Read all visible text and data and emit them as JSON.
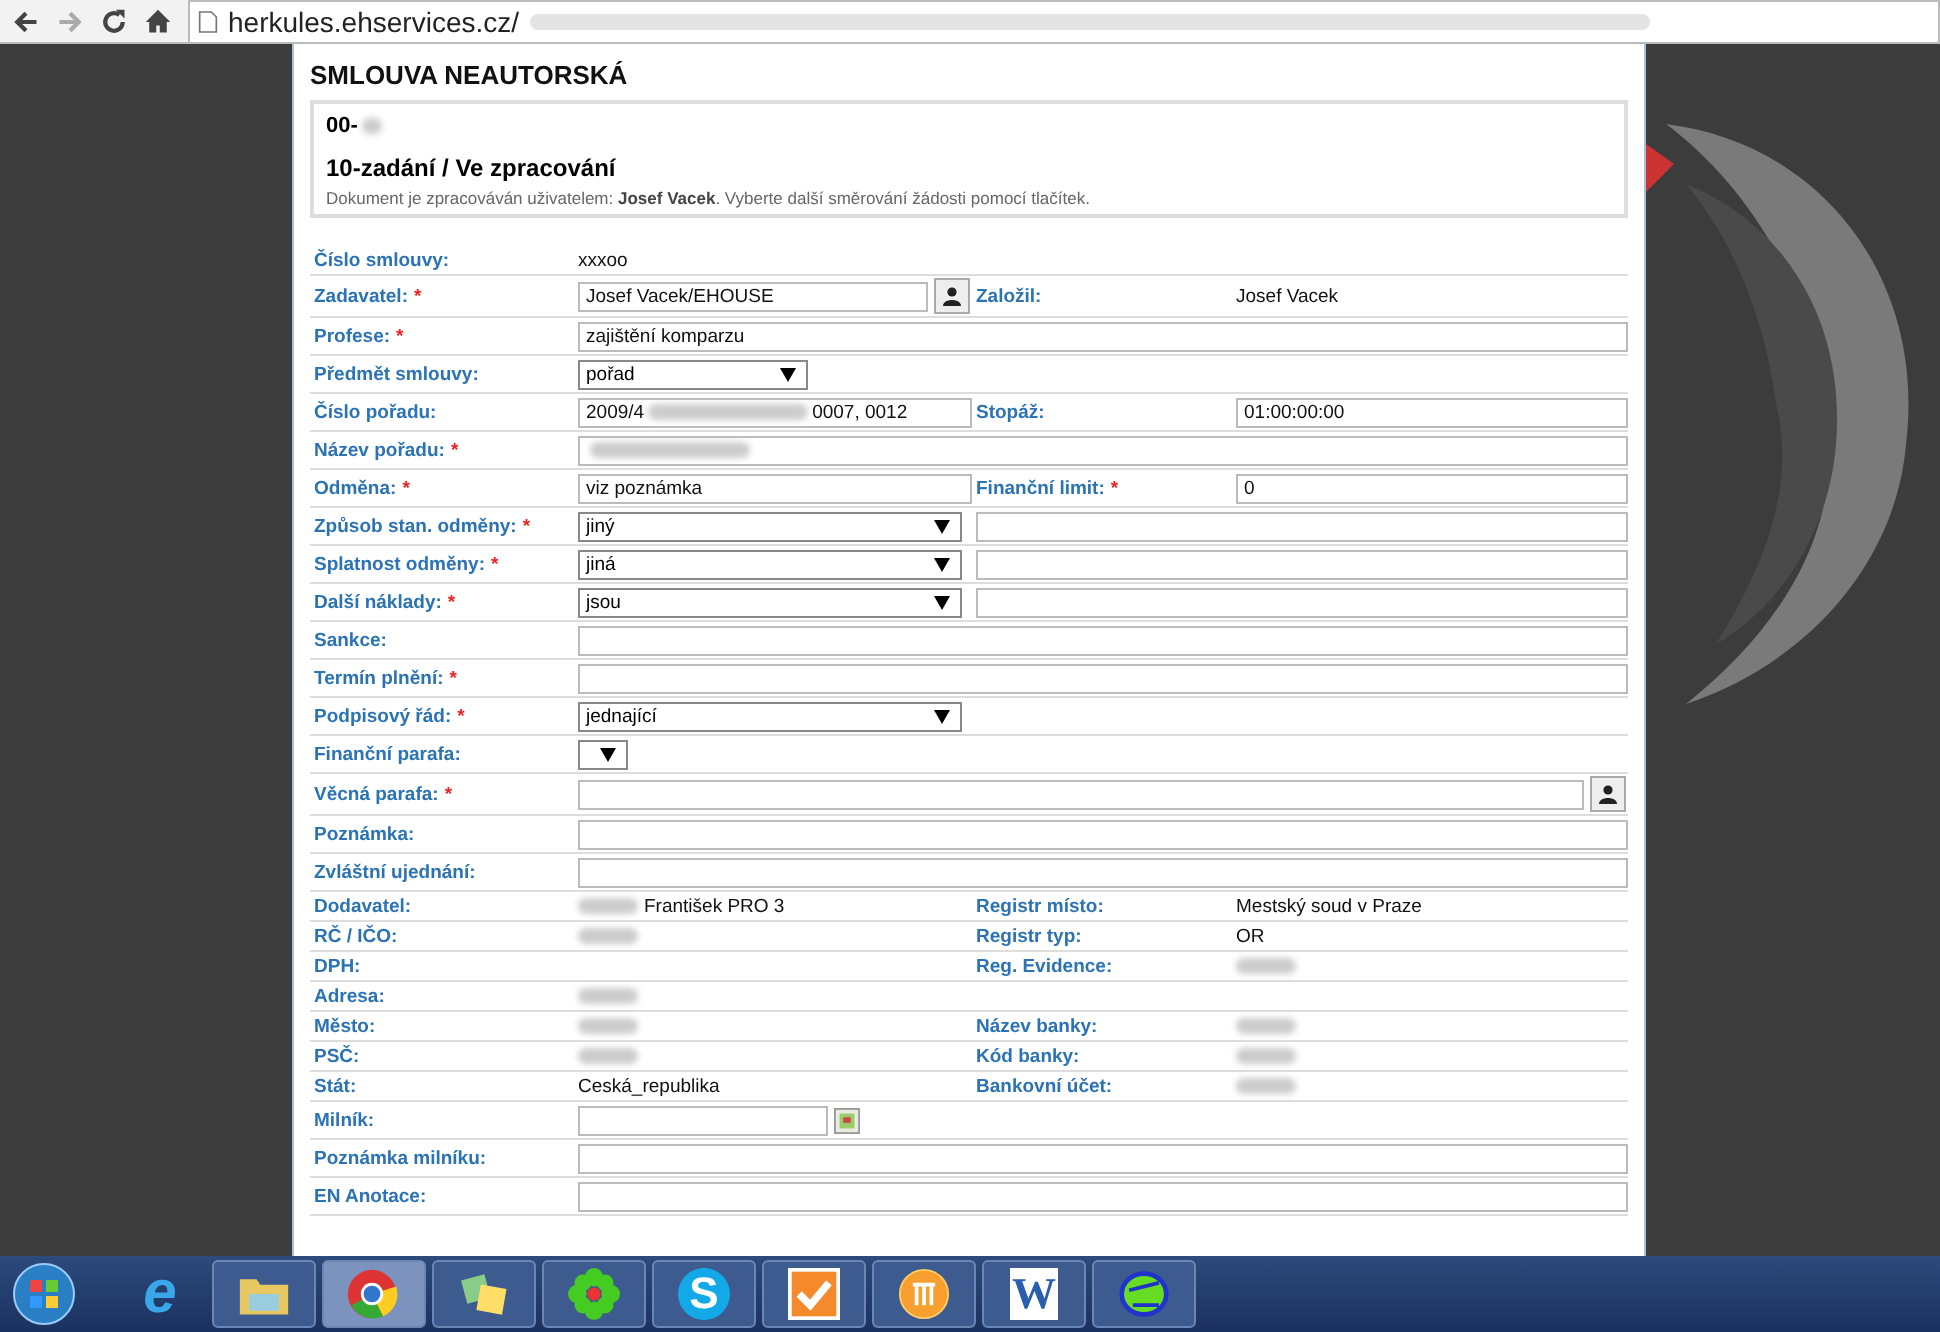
{
  "browser": {
    "url": "herkules.ehservices.cz/"
  },
  "form": {
    "title": "SMLOUVA NEAUTORSKÁ",
    "header": {
      "number": "00-",
      "status": "10-zadání / Ve zpracování",
      "note": "Dokument je zpracováván uživatelem: **Josef Vacek**. Vyberte další směrování žádosti pomocí tlačítek."
    },
    "rows": [
      {
        "label": "Číslo smlouvy:",
        "field": {
          "kind": "static",
          "value": "xxxoo"
        }
      },
      {
        "label": "Zadavatel:",
        "mark": "*",
        "field": {
          "kind": "input-person",
          "value": "Josef Vacek/EHOUSE"
        },
        "label2": "Založil:",
        "field2": {
          "kind": "static",
          "value": "Josef Vacek"
        }
      },
      {
        "label": "Profese:",
        "mark": "*",
        "field": {
          "kind": "input-full",
          "value": "zajištění komparzu"
        }
      },
      {
        "label": "Předmět smlouvy:",
        "field": {
          "kind": "select-short",
          "value": "pořad"
        }
      },
      {
        "label": "Číslo pořadu:",
        "field": {
          "kind": "input",
          "parts": [
            {
              "kind": "text",
              "text": "2009/4"
            },
            {
              "kind": "blur"
            },
            {
              "kind": "text",
              "text": "0007, 0012"
            }
          ]
        },
        "label2": "Stopáž:",
        "field2": {
          "kind": "input",
          "value": "01:00:00:00"
        }
      },
      {
        "label": "Název pořadu:",
        "mark": "*",
        "field": {
          "kind": "input-full",
          "parts": [
            {
              "kind": "blur"
            }
          ]
        }
      },
      {
        "label": "Odměna:",
        "mark": "*",
        "field": {
          "kind": "input",
          "value": "viz poznámka"
        },
        "label2": "Finanční limit:",
        "mark2": "*",
        "field2": {
          "kind": "input",
          "value": "0"
        }
      },
      {
        "label": "Způsob stan. odměny:",
        "mark": "*",
        "field": {
          "kind": "select",
          "value": "jiný"
        },
        "field2": {
          "kind": "input-wide"
        }
      },
      {
        "label": "Splatnost odměny:",
        "mark": "*",
        "field": {
          "kind": "select",
          "value": "jiná"
        },
        "field2": {
          "kind": "input-wide"
        }
      },
      {
        "label": "Další náklady:",
        "mark": "*",
        "field": {
          "kind": "select",
          "value": "jsou"
        },
        "field2": {
          "kind": "input-wide"
        }
      },
      {
        "label": "Sankce:",
        "field": {
          "kind": "input-full"
        }
      },
      {
        "label": "Termín plnění:",
        "mark": "*",
        "field": {
          "kind": "input-full"
        }
      },
      {
        "label": "Podpisový řád:",
        "mark": "*",
        "field": {
          "kind": "select",
          "value": "jednající"
        }
      },
      {
        "label": "Finanční parafa:",
        "field": {
          "kind": "select-tiny"
        }
      },
      {
        "label": "Věcná parafa:",
        "mark": "*",
        "field": {
          "kind": "input-full-person"
        }
      },
      {
        "label": "Poznámka:",
        "field": {
          "kind": "input-full"
        }
      },
      {
        "label": "Zvláštní ujednání:",
        "field": {
          "kind": "input-full"
        }
      },
      {
        "label": "Dodavatel:",
        "field": {
          "kind": "static",
          "parts": [
            {
              "kind": "blur"
            },
            {
              "kind": "text",
              "text": "František PRO 3"
            }
          ]
        },
        "label2": "Registr místo:",
        "field2": {
          "kind": "static",
          "value": "Mestský soud v Praze"
        }
      },
      {
        "label": "RČ / IČO:",
        "field": {
          "kind": "static",
          "parts": [
            {
              "kind": "blur"
            }
          ]
        },
        "label2": "Registr typ:",
        "field2": {
          "kind": "static",
          "value": "OR"
        }
      },
      {
        "label": "DPH:",
        "field": {
          "kind": "static"
        },
        "label2": "Reg. Evidence:",
        "field2": {
          "kind": "static",
          "parts": [
            {
              "kind": "blur"
            }
          ]
        }
      },
      {
        "label": "Adresa:",
        "field": {
          "kind": "static",
          "parts": [
            {
              "kind": "blur"
            }
          ]
        }
      },
      {
        "label": "Město:",
        "field": {
          "kind": "static",
          "parts": [
            {
              "kind": "blur"
            }
          ]
        },
        "label2": "Název banky:",
        "field2": {
          "kind": "static",
          "parts": [
            {
              "kind": "blur"
            }
          ]
        }
      },
      {
        "label": "PSČ:",
        "field": {
          "kind": "static",
          "parts": [
            {
              "kind": "blur"
            }
          ]
        },
        "label2": "Kód banky:",
        "field2": {
          "kind": "static",
          "parts": [
            {
              "kind": "blur"
            }
          ]
        }
      },
      {
        "label": "Stát:",
        "field": {
          "kind": "static",
          "value": "Ceská_republika"
        },
        "label2": "Bankovní účet:",
        "field2": {
          "kind": "static",
          "parts": [
            {
              "kind": "blur"
            }
          ]
        }
      },
      {
        "label": "Milník:",
        "field": {
          "kind": "date"
        }
      },
      {
        "label": "Poznámka milníku:",
        "field": {
          "kind": "input-full"
        }
      },
      {
        "label": "EN Anotace:",
        "field": {
          "kind": "input-full"
        }
      }
    ]
  },
  "taskbar": [
    {
      "kind": "ie",
      "glyph": "e",
      "selected": false
    },
    {
      "kind": "folder",
      "selected": false
    },
    {
      "kind": "chrome",
      "selected": true
    },
    {
      "kind": "notes",
      "selected": false
    },
    {
      "kind": "flower",
      "selected": false
    },
    {
      "kind": "skype",
      "glyph": "S",
      "selected": false
    },
    {
      "kind": "check",
      "selected": false
    },
    {
      "kind": "orange",
      "selected": false
    },
    {
      "kind": "word",
      "glyph": "W",
      "selected": false
    },
    {
      "kind": "green",
      "selected": false
    }
  ]
}
